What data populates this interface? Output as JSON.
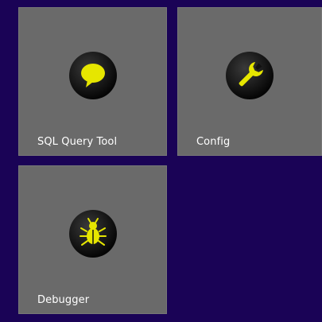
{
  "colors": {
    "background": "#1a0356",
    "tile": "#6a6a6a",
    "icon_disc": "#0a0a0a",
    "icon_accent": "#e6e600",
    "label_text": "#ffffff"
  },
  "tiles": [
    {
      "label": "SQL Query Tool",
      "icon": "chat-bubble-icon"
    },
    {
      "label": "Config",
      "icon": "wrench-icon"
    },
    {
      "label": "Debugger",
      "icon": "bug-icon"
    }
  ]
}
